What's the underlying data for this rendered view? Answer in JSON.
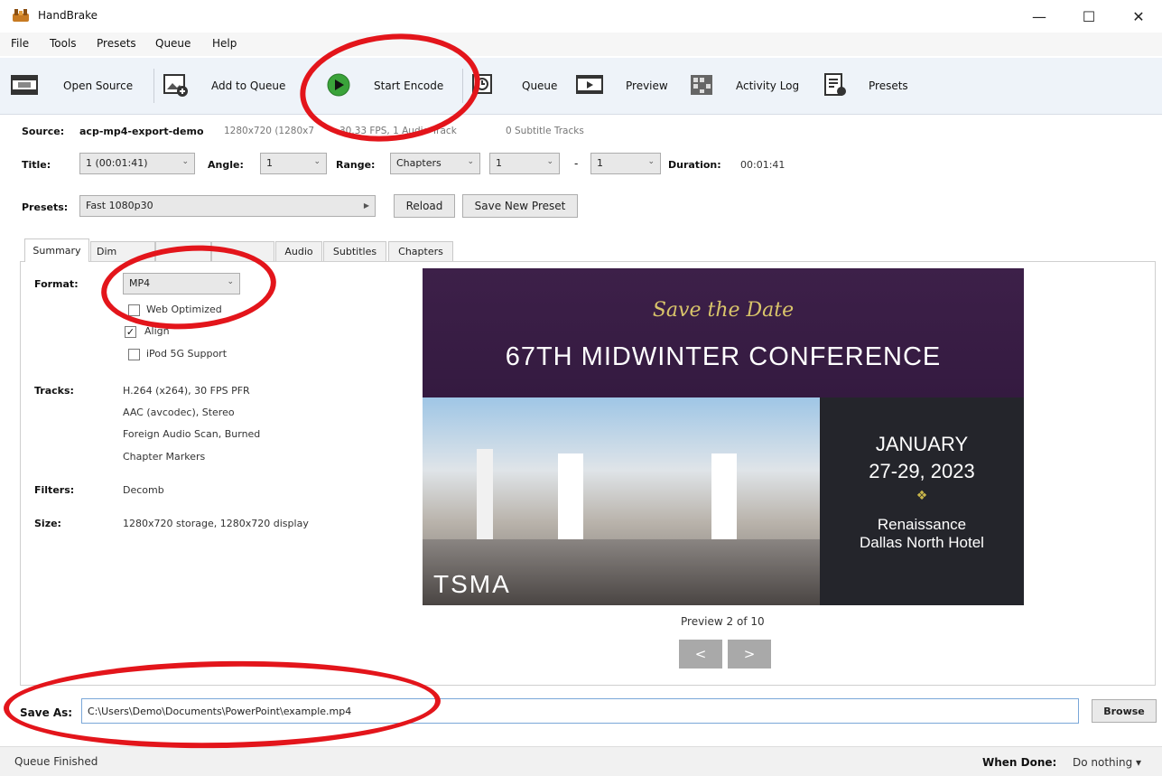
{
  "window": {
    "title": "HandBrake",
    "minimize": "—",
    "maximize": "☐",
    "close": "✕"
  },
  "menu": [
    "File",
    "Tools",
    "Presets",
    "Queue",
    "Help"
  ],
  "toolbar": {
    "open_source": "Open Source",
    "add_to_queue": "Add to Queue",
    "start_encode": "Start Encode",
    "queue": "Queue",
    "preview": "Preview",
    "activity_log": "Activity Log",
    "presets": "Presets"
  },
  "source": {
    "label": "Source:",
    "name": "acp-mp4-export-demo",
    "details": "1280x720 (1280x7",
    "details2": "30.33 FPS, 1 Audio Track",
    "details3": "0 Subtitle Tracks"
  },
  "title_row": {
    "title_label": "Title:",
    "title_value": "1 (00:01:41)",
    "angle_label": "Angle:",
    "angle_value": "1",
    "range_label": "Range:",
    "range_value": "Chapters",
    "range_start": "1",
    "range_dash": "-",
    "range_end": "1",
    "duration_label": "Duration:",
    "duration_value": "00:01:41"
  },
  "presets_row": {
    "label": "Presets:",
    "value": "Fast 1080p30",
    "reload": "Reload",
    "save_new": "Save New Preset"
  },
  "tabs": [
    "Summary",
    "Dim",
    "Audio",
    "Subtitles",
    "Chapters"
  ],
  "summary": {
    "format_label": "Format:",
    "format_value": "MP4",
    "web_optimized": "Web Optimized",
    "align_av": "Align",
    "ipod": "iPod 5G Support",
    "tracks_label": "Tracks:",
    "tracks": [
      "H.264 (x264), 30 FPS PFR",
      "AAC (avcodec), Stereo",
      "Foreign Audio Scan, Burned",
      "Chapter Markers"
    ],
    "filters_label": "Filters:",
    "filters_value": "Decomb",
    "size_label": "Size:",
    "size_value": "1280x720 storage, 1280x720 display"
  },
  "preview": {
    "script_line": "Save the Date",
    "headline": "67TH MIDWINTER CONFERENCE",
    "date_line1": "JANUARY",
    "date_line2": "27-29, 2023",
    "venue_line1": "Renaissance",
    "venue_line2": "Dallas North Hotel",
    "logo": "TSMA",
    "caption": "Preview 2 of 10",
    "prev": "<",
    "next": ">"
  },
  "save_as": {
    "label": "Save As:",
    "value": "C:\\Users\\Demo\\Documents\\PowerPoint\\example.mp4",
    "browse": "Browse"
  },
  "status": {
    "left": "Queue Finished",
    "when_done_label": "When Done:",
    "when_done_value": "Do nothing ▾"
  },
  "colors": {
    "annotation_red": "#e3151b",
    "play_green": "#3aa33a",
    "preview_purple": "#3b1e47"
  }
}
